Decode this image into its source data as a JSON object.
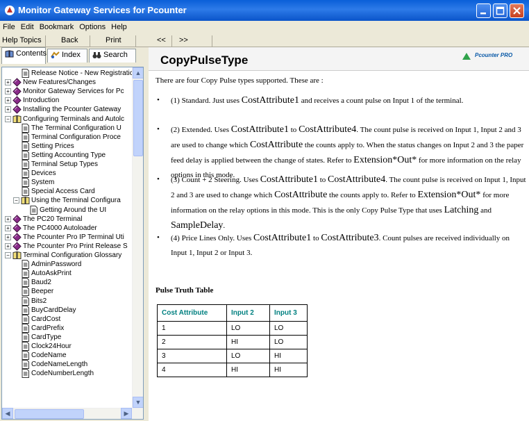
{
  "window": {
    "title": "Monitor Gateway Services for Pcounter"
  },
  "menu": [
    "File",
    "Edit",
    "Bookmark",
    "Options",
    "Help"
  ],
  "toolbar": {
    "help_topics": "Help Topics",
    "back": "Back",
    "print": "Print",
    "prev": "<<",
    "next": ">>"
  },
  "tabs": {
    "contents": "Contents",
    "index": "Index",
    "search": "Search"
  },
  "tree": [
    {
      "label": "Release Notice - New Registratic",
      "icon": "page",
      "expander": "",
      "level": 1
    },
    {
      "label": "New Features/Changes",
      "icon": "book-closed",
      "expander": "+",
      "level": 0
    },
    {
      "label": "Monitor Gateway Services for Pc",
      "icon": "book-closed",
      "expander": "+",
      "level": 0
    },
    {
      "label": "Introduction",
      "icon": "book-closed",
      "expander": "+",
      "level": 0
    },
    {
      "label": "Installing the Pcounter Gateway",
      "icon": "book-closed",
      "expander": "+",
      "level": 0
    },
    {
      "label": "Configuring Terminals and Autolc",
      "icon": "book-open",
      "expander": "-",
      "level": 0
    },
    {
      "label": "The Terminal Configuration U",
      "icon": "page",
      "expander": "",
      "level": 1
    },
    {
      "label": "Terminal Configuration Proce",
      "icon": "page",
      "expander": "",
      "level": 1
    },
    {
      "label": "Setting Prices",
      "icon": "page",
      "expander": "",
      "level": 1
    },
    {
      "label": "Setting Accounting Type",
      "icon": "page",
      "expander": "",
      "level": 1
    },
    {
      "label": "Terminal Setup Types",
      "icon": "page",
      "expander": "",
      "level": 1
    },
    {
      "label": "Devices",
      "icon": "page",
      "expander": "",
      "level": 1
    },
    {
      "label": "System",
      "icon": "page",
      "expander": "",
      "level": 1
    },
    {
      "label": "Special Access Card",
      "icon": "page",
      "expander": "",
      "level": 1
    },
    {
      "label": "Using the Terminal Configura",
      "icon": "book-open",
      "expander": "-",
      "level": 1
    },
    {
      "label": "Getting Around the UI",
      "icon": "page",
      "expander": "",
      "level": 2
    },
    {
      "label": "The PC20 Terminal",
      "icon": "book-closed",
      "expander": "+",
      "level": 0
    },
    {
      "label": "The PC4000 Autoloader",
      "icon": "book-closed",
      "expander": "+",
      "level": 0
    },
    {
      "label": "The Pcounter Pro IP Terminal Uti",
      "icon": "book-closed",
      "expander": "+",
      "level": 0
    },
    {
      "label": "The Pcounter Pro Print Release S",
      "icon": "book-closed",
      "expander": "+",
      "level": 0
    },
    {
      "label": "Terminal Configuration Glossary",
      "icon": "book-open",
      "expander": "-",
      "level": 0
    },
    {
      "label": "AdminPassword",
      "icon": "page",
      "expander": "",
      "level": 1
    },
    {
      "label": "AutoAskPrint",
      "icon": "page",
      "expander": "",
      "level": 1
    },
    {
      "label": "Baud2",
      "icon": "page",
      "expander": "",
      "level": 1
    },
    {
      "label": "Beeper",
      "icon": "page",
      "expander": "",
      "level": 1
    },
    {
      "label": "Bits2",
      "icon": "page",
      "expander": "",
      "level": 1
    },
    {
      "label": "BuyCardDelay",
      "icon": "page",
      "expander": "",
      "level": 1
    },
    {
      "label": "CardCost",
      "icon": "page",
      "expander": "",
      "level": 1
    },
    {
      "label": "CardPrefix",
      "icon": "page",
      "expander": "",
      "level": 1
    },
    {
      "label": "CardType",
      "icon": "page",
      "expander": "",
      "level": 1
    },
    {
      "label": "Clock24Hour",
      "icon": "page",
      "expander": "",
      "level": 1
    },
    {
      "label": "CodeName",
      "icon": "page",
      "expander": "",
      "level": 1
    },
    {
      "label": "CodeNameLength",
      "icon": "page",
      "expander": "",
      "level": 1
    },
    {
      "label": "CodeNumberLength",
      "icon": "page",
      "expander": "",
      "level": 1
    }
  ],
  "content": {
    "title": "CopyPulseType",
    "logo_text": "Pcounter PRO",
    "intro": "There are four Copy Pulse types supported.  These are :",
    "bullets": [
      [
        {
          "t": "(1) Standard.  Just uses "
        },
        {
          "t": "CostAttribute1",
          "big": true
        },
        {
          "t": " and receives a count pulse on Input 1 of the terminal."
        }
      ],
      [
        {
          "t": "(2) Extended.  Uses "
        },
        {
          "t": "CostAttribute1",
          "big": true
        },
        {
          "t": " to "
        },
        {
          "t": "CostAttribute4",
          "big": true
        },
        {
          "t": ". The count pulse is received on Input 1, Input 2 and 3 are used to change which "
        },
        {
          "t": "CostAttribute",
          "big": true
        },
        {
          "t": " the counts apply to.  When the status changes on Input 2 and 3 the paper feed delay is applied between the change of states.  Refer to "
        },
        {
          "t": "Extension*Out*",
          "big": true
        },
        {
          "t": " for more information on the relay options in this mode."
        }
      ],
      [
        {
          "t": "(3) Count + 2 Steering.  Uses "
        },
        {
          "t": "CostAttribute1",
          "big": true
        },
        {
          "t": " to "
        },
        {
          "t": "CostAttribute4",
          "big": true
        },
        {
          "t": ". The count pulse is received on Input 1, Input 2 and 3 are used to change which "
        },
        {
          "t": "CostAttribute",
          "big": true
        },
        {
          "t": " the counts apply to.  Refer to "
        },
        {
          "t": "Extension*Out*",
          "big": true
        },
        {
          "t": " for more information on the relay options in this mode.  This is the only Copy Pulse Type that uses "
        },
        {
          "t": "Latching",
          "big": true
        },
        {
          "t": " and "
        },
        {
          "t": "SampleDelay",
          "big": true
        },
        {
          "t": "."
        }
      ],
      [
        {
          "t": "(4) Price Lines Only.  Uses "
        },
        {
          "t": "CostAttribute1",
          "big": true
        },
        {
          "t": " to "
        },
        {
          "t": "CostAttribute3",
          "big": true
        },
        {
          "t": ".  Count pulses are received individually on Input 1, Input 2 or Input 3."
        }
      ]
    ],
    "table_title": "Pulse Truth Table",
    "table": {
      "headers": [
        "Cost Attribute",
        "Input 2",
        "Input 3"
      ],
      "rows": [
        [
          "1",
          "LO",
          "LO"
        ],
        [
          "2",
          "HI",
          "LO"
        ],
        [
          "3",
          "LO",
          "HI"
        ],
        [
          "4",
          "HI",
          "HI"
        ]
      ]
    }
  },
  "colors": {
    "titlebar": "#0a5fd8",
    "table_header": "#008080",
    "logo_triangle": "#2fa24a"
  }
}
